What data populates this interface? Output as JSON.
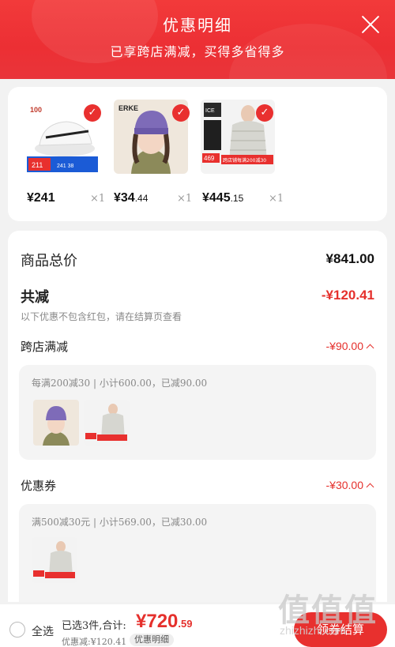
{
  "header": {
    "title": "优惠明细",
    "subtitle": "已享跨店满减，买得多省得多"
  },
  "products": [
    {
      "price_int": "¥241",
      "price_dec": "",
      "qty": "×1",
      "brand": "100"
    },
    {
      "price_int": "¥34",
      "price_dec": ".44",
      "qty": "×1",
      "brand": "ERKE"
    },
    {
      "price_int": "¥445",
      "price_dec": ".15",
      "qty": "×1",
      "brand": "ICE"
    }
  ],
  "product_badges": {
    "p1_badge": "211",
    "p1_sub": "241 38",
    "p3_badge": "469",
    "p3_promo": "跨店铺每满200减30"
  },
  "summary": {
    "total_label": "商品总价",
    "total_value": "¥841.00",
    "reduce_label": "共减",
    "reduce_value": "-¥120.41",
    "note": "以下优惠不包含红包，请在结算页查看"
  },
  "cross_store": {
    "label": "跨店满减",
    "value": "-¥90.00",
    "detail": "每满200减30 | 小计600.00，已减90.00"
  },
  "coupon": {
    "label": "优惠券",
    "value": "-¥30.00",
    "detail": "满500减30元 | 小计569.00，已减30.00"
  },
  "bottom": {
    "select_all": "全选",
    "selected_info": "已选3件,合计:",
    "total_int": "¥720",
    "total_dec": ".59",
    "discount": "优惠减:¥120.41",
    "detail_tag": "优惠明细",
    "checkout": "领券结算"
  },
  "watermark": {
    "logo": "值值值",
    "url": "zhizhizhi.com"
  },
  "colors": {
    "brand_red": "#e5302c",
    "header_red": "#f23a3a"
  }
}
